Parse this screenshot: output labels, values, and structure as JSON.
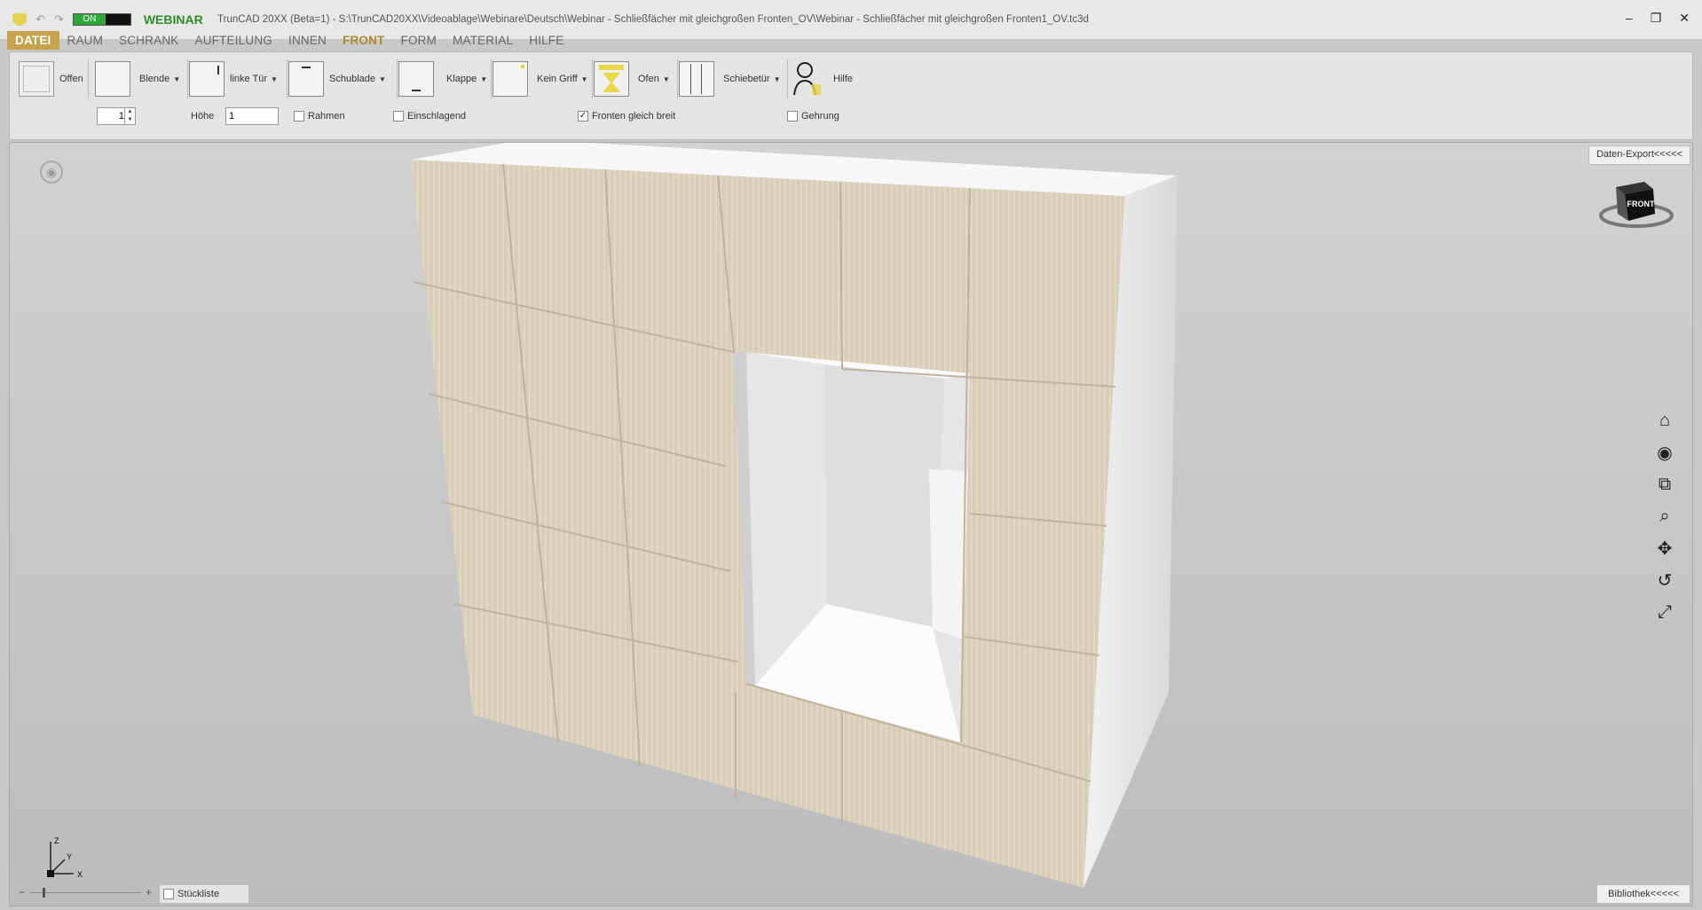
{
  "titlebar": {
    "toggle_on": "ON",
    "app_mode": "WEBINAR",
    "window_title": "TrunCAD 20XX (Beta=1)  - S:\\TrunCAD20XX\\Videoablage\\Webinare\\Deutsch\\Webinar - Schließfächer mit gleichgroßen Fronten_OV\\Webinar - Schließfächer mit gleichgroßen Fronten1_OV.tc3d",
    "minimize": "–",
    "restore": "❐",
    "close": "✕"
  },
  "menu": [
    "DATEI",
    "RAUM",
    "SCHRANK",
    "AUFTEILUNG",
    "INNEN",
    "FRONT",
    "FORM",
    "MATERIAL",
    "HILFE"
  ],
  "ribbon": {
    "tools": {
      "offen": "Offen",
      "blende": "Blende",
      "linke_tuer": "linke Tür",
      "schublade": "Schublade",
      "klappe": "Klappe",
      "kein_griff": "Kein Griff",
      "ofen": "Ofen",
      "schiebetuer": "Schiebetür",
      "hilfe": "Hilfe"
    },
    "count_value": "1",
    "hoehe_label": "Höhe",
    "hoehe_value": "1",
    "rahmen": "Rahmen",
    "einschlagend": "Einschlagend",
    "fronten_gleich_breit": "Fronten gleich breit",
    "fronten_checked": "✓",
    "gehrung": "Gehrung"
  },
  "viewport": {
    "daten_export": "Daten-Export<<<<<",
    "bibliothek": "Bibliothek<<<<<",
    "navcube_label": "FRONT",
    "axis_z": "Z",
    "axis_y": "Y",
    "axis_x": "X",
    "stueckliste": "Stückliste",
    "zoom_minus": "−",
    "zoom_plus": "+"
  },
  "colors": {
    "accent": "#c9a24e",
    "webinar": "#2e8b2e",
    "toggle_on": "#2ea83a",
    "wood": "#ddd2c0"
  }
}
